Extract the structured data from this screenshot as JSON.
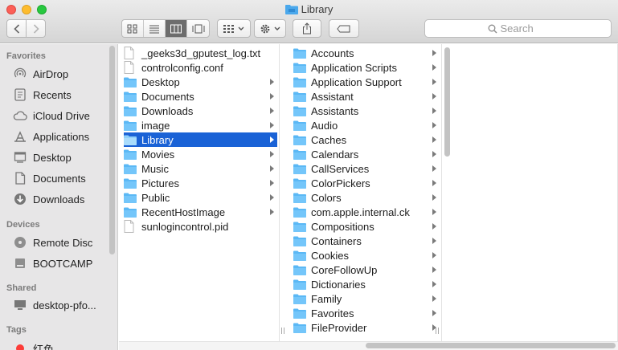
{
  "window": {
    "title": "Library"
  },
  "search": {
    "placeholder": "Search"
  },
  "sidebar": {
    "sections": [
      {
        "header": "Favorites",
        "items": [
          {
            "label": "AirDrop",
            "icon": "airdrop-icon"
          },
          {
            "label": "Recents",
            "icon": "recents-icon"
          },
          {
            "label": "iCloud Drive",
            "icon": "cloud-icon"
          },
          {
            "label": "Applications",
            "icon": "applications-icon"
          },
          {
            "label": "Desktop",
            "icon": "desktop-icon"
          },
          {
            "label": "Documents",
            "icon": "document-icon"
          },
          {
            "label": "Downloads",
            "icon": "downloads-icon"
          }
        ]
      },
      {
        "header": "Devices",
        "items": [
          {
            "label": "Remote Disc",
            "icon": "disc-icon"
          },
          {
            "label": "BOOTCAMP",
            "icon": "drive-icon"
          }
        ]
      },
      {
        "header": "Shared",
        "items": [
          {
            "label": "desktop-pfo...",
            "icon": "computer-icon"
          }
        ]
      },
      {
        "header": "Tags",
        "items": [
          {
            "label": "红色",
            "icon": "red-tag-icon"
          }
        ]
      }
    ]
  },
  "column1": [
    {
      "label": "_geeks3d_gputest_log.txt",
      "kind": "file",
      "arrow": false
    },
    {
      "label": "controlconfig.conf",
      "kind": "file",
      "arrow": false
    },
    {
      "label": "Desktop",
      "kind": "folder",
      "arrow": true
    },
    {
      "label": "Documents",
      "kind": "folder",
      "arrow": true
    },
    {
      "label": "Downloads",
      "kind": "folder",
      "arrow": true
    },
    {
      "label": "image",
      "kind": "folder",
      "arrow": true
    },
    {
      "label": "Library",
      "kind": "folder",
      "arrow": true,
      "selected": true
    },
    {
      "label": "Movies",
      "kind": "folder",
      "arrow": true
    },
    {
      "label": "Music",
      "kind": "folder",
      "arrow": true
    },
    {
      "label": "Pictures",
      "kind": "folder",
      "arrow": true
    },
    {
      "label": "Public",
      "kind": "folder",
      "arrow": true
    },
    {
      "label": "RecentHostImage",
      "kind": "folder",
      "arrow": true
    },
    {
      "label": "sunlogincontrol.pid",
      "kind": "file",
      "arrow": false
    }
  ],
  "column2": [
    {
      "label": "Accounts"
    },
    {
      "label": "Application Scripts"
    },
    {
      "label": "Application Support"
    },
    {
      "label": "Assistant"
    },
    {
      "label": "Assistants"
    },
    {
      "label": "Audio"
    },
    {
      "label": "Caches"
    },
    {
      "label": "Calendars"
    },
    {
      "label": "CallServices"
    },
    {
      "label": "ColorPickers"
    },
    {
      "label": "Colors"
    },
    {
      "label": "com.apple.internal.ck"
    },
    {
      "label": "Compositions"
    },
    {
      "label": "Containers"
    },
    {
      "label": "Cookies"
    },
    {
      "label": "CoreFollowUp"
    },
    {
      "label": "Dictionaries"
    },
    {
      "label": "Family"
    },
    {
      "label": "Favorites"
    },
    {
      "label": "FileProvider"
    }
  ],
  "colors": {
    "selection": "#1a62d6",
    "folder": "#5bb8f5",
    "sidebar": "#e7e6e7"
  }
}
